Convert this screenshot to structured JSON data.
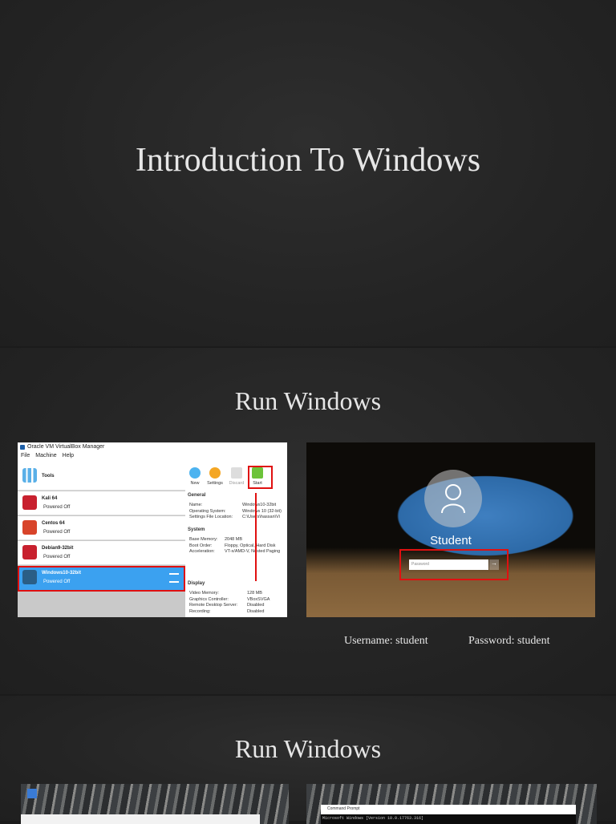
{
  "slides": [
    {
      "title": "Introduction To Windows"
    },
    {
      "title": "Run Windows",
      "virtualbox": {
        "window_title": "Oracle VM VirtualBox Manager",
        "menu": [
          "File",
          "Machine",
          "Help"
        ],
        "tools_label": "Tools",
        "toolbar": [
          "New",
          "Settings",
          "Discard",
          "Start"
        ],
        "vms": [
          {
            "name": "Kali 64",
            "state": "Powered Off"
          },
          {
            "name": "Centos 64",
            "state": "Powered Off"
          },
          {
            "name": "Debian9-32bit",
            "state": "Powered Off"
          },
          {
            "name": "Windows10-32bit",
            "state": "Powered Off"
          }
        ],
        "general": {
          "heading": "General",
          "keys": "Name:\nOperating System:\nSettings File Location:",
          "values": "Windows10-32bit\nWindows 10 (32-bit)\nC:\\Users\\hassan\\Vi"
        },
        "system": {
          "heading": "System",
          "keys": "Base Memory:\nBoot Order:\nAcceleration:",
          "values": "2048 MB\nFloppy, Optical, Hard Disk\nVT-x/AMD-V, Nested Paging"
        },
        "display": {
          "heading": "Display",
          "keys": "Video Memory:\nGraphics Controller:\nRemote Desktop Server:\nRecording:",
          "values": "128 MB\nVBoxSVGA\nDisabled\nDisabled"
        }
      },
      "login": {
        "user": "Student",
        "password_placeholder": "Password"
      },
      "username_label": "Username: student",
      "password_label": "Password: student"
    },
    {
      "title": "Run Windows",
      "cmd_title": "Command Prompt",
      "cmd_line": "Microsoft Windows [Version 10.0.17763.316]"
    }
  ]
}
